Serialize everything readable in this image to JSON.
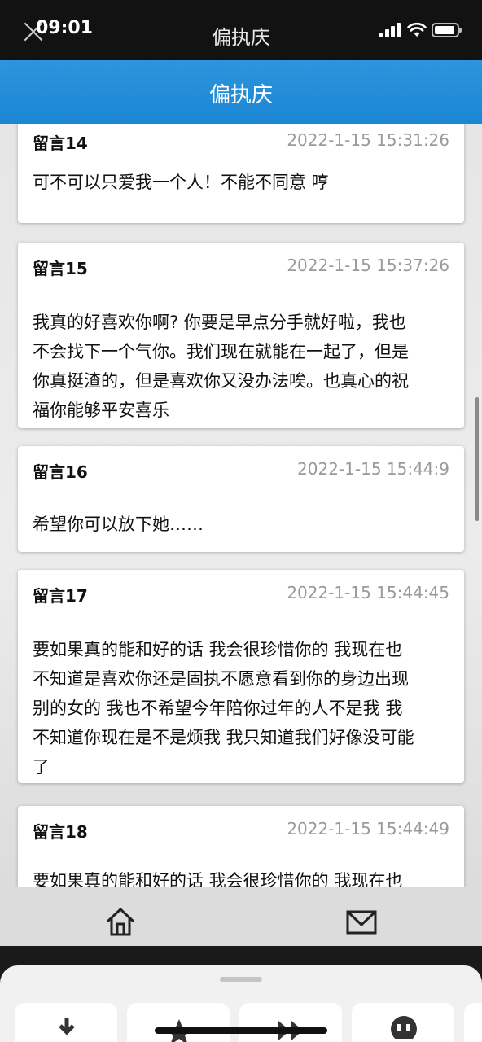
{
  "status_bar": {
    "time": "09:01",
    "title": "偏执庆",
    "icons": [
      "close-icon",
      "signal-icon",
      "wifi-icon",
      "battery-icon"
    ]
  },
  "header": {
    "title": "偏执庆"
  },
  "messages": [
    {
      "title": "留言14",
      "time": "2022-1-15 15:31:26",
      "lines": [
        "可不可以只爱我一个人！不能不同意 哼"
      ]
    },
    {
      "title": "留言15",
      "time": "2022-1-15 15:37:26",
      "lines": [
        "我真的好喜欢你啊? 你要是早点分手就好啦，我也",
        "不会找下一个气你。我们现在就能在一起了，但是",
        "你真挺渣的，但是喜欢你又没办法唉。也真心的祝",
        "福你能够平安喜乐"
      ]
    },
    {
      "title": "留言16",
      "time": "2022-1-15 15:44:9",
      "lines": [
        "希望你可以放下她……"
      ]
    },
    {
      "title": "留言17",
      "time": "2022-1-15 15:44:45",
      "lines": [
        "要如果真的能和好的话 我会很珍惜你的 我现在也",
        "不知道是喜欢你还是固执不愿意看到你的身边出现",
        "别的女的 我也不希望今年陪你过年的人不是我 我",
        "不知道你现在是不是烦我 我只知道我们好像没可能",
        "了"
      ]
    },
    {
      "title": "留言18",
      "time": "2022-1-15 15:44:49",
      "lines": [
        "要如果真的能和好的话 我会很珍惜你的 我现在也"
      ]
    }
  ],
  "tabbar": {
    "tabs": [
      {
        "icon": "home-icon"
      },
      {
        "icon": "mail-icon"
      }
    ],
    "accent": "#2c95dd"
  },
  "sheet": {
    "icons": [
      "download-icon",
      "star-icon",
      "forward-icon",
      "chat-icon"
    ]
  },
  "colors": {
    "header_blue": "#1b86d5",
    "status_bg": "#121212"
  }
}
